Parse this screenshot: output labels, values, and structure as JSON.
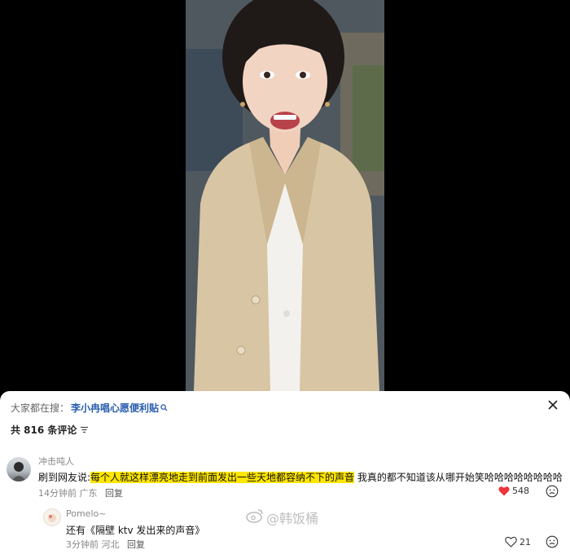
{
  "search": {
    "prefix": "大家都在搜：",
    "term": "李小冉唱心愿便利贴"
  },
  "comments_header": {
    "count_text": "共 816 条评论"
  },
  "comments": [
    {
      "user": "冲击吨人",
      "text_prefix": "刷到网友说:",
      "text_highlight": "每个人就这样漂亮地走到前面发出一些天地都容纳不下的声音",
      "text_suffix": " 我真的都不知道该从哪开始笑哈哈哈哈哈哈哈哈",
      "time": "14分钟前",
      "location": "广东",
      "reply_label": "回复",
      "likes": "548"
    },
    {
      "user": "Pomelo~",
      "text": "还有《隔壁 ktv 发出来的声音》",
      "time": "3分钟前",
      "location": "河北",
      "reply_label": "回复",
      "likes": "21"
    }
  ],
  "watermark": {
    "text": "@韩饭桶"
  },
  "colors": {
    "link": "#2a5db0",
    "highlight": "#ffe600",
    "like_active": "#f0333c"
  }
}
